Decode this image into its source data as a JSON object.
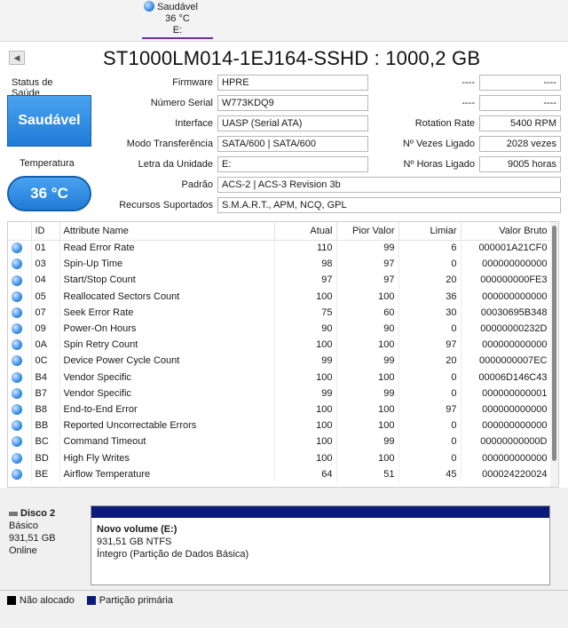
{
  "tab": {
    "status": "Saudável",
    "temp": "36 °C",
    "drive": "E:"
  },
  "title": "ST1000LM014-1EJ164-SSHD : 1000,2 GB",
  "health": {
    "label": "Status de Saúde",
    "value": "Saudável"
  },
  "temperature": {
    "label": "Temperatura",
    "value": "36 °C"
  },
  "info": {
    "firmware": {
      "label": "Firmware",
      "value": "HPRE"
    },
    "serial": {
      "label": "Número Serial",
      "value": "W773KDQ9"
    },
    "interface": {
      "label": "Interface",
      "value": "UASP (Serial ATA)"
    },
    "transfer": {
      "label": "Modo Transferência",
      "value": "SATA/600 | SATA/600"
    },
    "letter": {
      "label": "Letra da Unidade",
      "value": "E:"
    },
    "standard": {
      "label": "Padrão",
      "value": "ACS-2 | ACS-3 Revision 3b"
    },
    "features": {
      "label": "Recursos Suportados",
      "value": "S.M.A.R.T., APM, NCQ, GPL"
    },
    "blank1": {
      "label": "----",
      "value": "----"
    },
    "blank2": {
      "label": "----",
      "value": "----"
    },
    "rotation": {
      "label": "Rotation Rate",
      "value": "5400 RPM"
    },
    "power_count": {
      "label": "Nº Vezes Ligado",
      "value": "2028 vezes"
    },
    "power_hours": {
      "label": "Nº Horas Ligado",
      "value": "9005 horas"
    }
  },
  "smart": {
    "headers": {
      "id": "ID",
      "name": "Attribute Name",
      "current": "Atual",
      "worst": "Pior Valor",
      "threshold": "Limiar",
      "raw": "Valor Bruto"
    },
    "rows": [
      {
        "id": "01",
        "name": "Read Error Rate",
        "current": "110",
        "worst": "99",
        "threshold": "6",
        "raw": "000001A21CF0"
      },
      {
        "id": "03",
        "name": "Spin-Up Time",
        "current": "98",
        "worst": "97",
        "threshold": "0",
        "raw": "000000000000"
      },
      {
        "id": "04",
        "name": "Start/Stop Count",
        "current": "97",
        "worst": "97",
        "threshold": "20",
        "raw": "000000000FE3"
      },
      {
        "id": "05",
        "name": "Reallocated Sectors Count",
        "current": "100",
        "worst": "100",
        "threshold": "36",
        "raw": "000000000000"
      },
      {
        "id": "07",
        "name": "Seek Error Rate",
        "current": "75",
        "worst": "60",
        "threshold": "30",
        "raw": "00030695B348"
      },
      {
        "id": "09",
        "name": "Power-On Hours",
        "current": "90",
        "worst": "90",
        "threshold": "0",
        "raw": "00000000232D"
      },
      {
        "id": "0A",
        "name": "Spin Retry Count",
        "current": "100",
        "worst": "100",
        "threshold": "97",
        "raw": "000000000000"
      },
      {
        "id": "0C",
        "name": "Device Power Cycle Count",
        "current": "99",
        "worst": "99",
        "threshold": "20",
        "raw": "0000000007EC"
      },
      {
        "id": "B4",
        "name": "Vendor Specific",
        "current": "100",
        "worst": "100",
        "threshold": "0",
        "raw": "00006D146C43"
      },
      {
        "id": "B7",
        "name": "Vendor Specific",
        "current": "99",
        "worst": "99",
        "threshold": "0",
        "raw": "000000000001"
      },
      {
        "id": "B8",
        "name": "End-to-End Error",
        "current": "100",
        "worst": "100",
        "threshold": "97",
        "raw": "000000000000"
      },
      {
        "id": "BB",
        "name": "Reported Uncorrectable Errors",
        "current": "100",
        "worst": "100",
        "threshold": "0",
        "raw": "000000000000"
      },
      {
        "id": "BC",
        "name": "Command Timeout",
        "current": "100",
        "worst": "99",
        "threshold": "0",
        "raw": "00000000000D"
      },
      {
        "id": "BD",
        "name": "High Fly Writes",
        "current": "100",
        "worst": "100",
        "threshold": "0",
        "raw": "000000000000"
      },
      {
        "id": "BE",
        "name": "Airflow Temperature",
        "current": "64",
        "worst": "51",
        "threshold": "45",
        "raw": "000024220024"
      }
    ]
  },
  "disk": {
    "name": "Disco 2",
    "type": "Básico",
    "size": "931,51 GB",
    "state": "Online",
    "volume_name": "Novo volume  (E:)",
    "volume_size": "931,51 GB NTFS",
    "volume_status": "Íntegro (Partição de Dados Básica)"
  },
  "legend": {
    "unallocated": "Não alocado",
    "primary": "Partição primária"
  },
  "colors": {
    "health": "#1f7bd6",
    "partition": "#0c1a7a",
    "unallocated": "#000000"
  }
}
